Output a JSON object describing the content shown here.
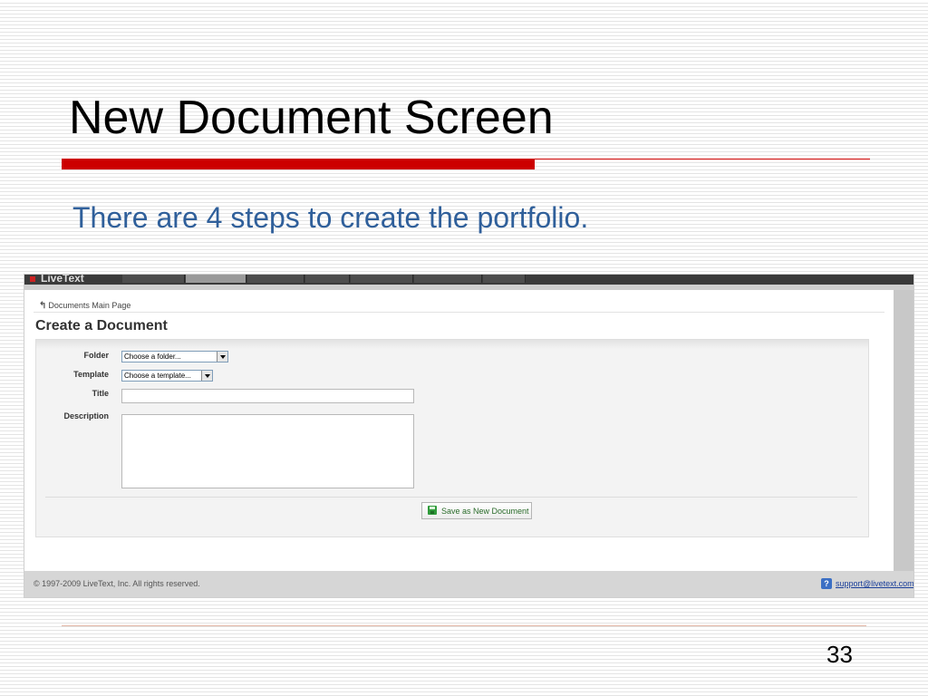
{
  "slide": {
    "title": "New Document Screen",
    "subtitle": "There are 4 steps to create the portfolio.",
    "page_number": "33",
    "accent_color": "#cc0000",
    "subtitle_color": "#2f5f9a"
  },
  "app": {
    "logo": "LiveText",
    "breadcrumb": "Documents Main Page",
    "page_heading": "Create a Document",
    "form": {
      "folder_label": "Folder",
      "folder_value": "Choose a folder...",
      "template_label": "Template",
      "template_value": "Choose a template...",
      "title_label": "Title",
      "title_value": "",
      "description_label": "Description",
      "description_value": ""
    },
    "save_label": "Save as New Document",
    "footer": {
      "copyright": "© 1997-2009 LiveText, Inc. All rights reserved.",
      "support_email": "support@livetext.com"
    }
  }
}
